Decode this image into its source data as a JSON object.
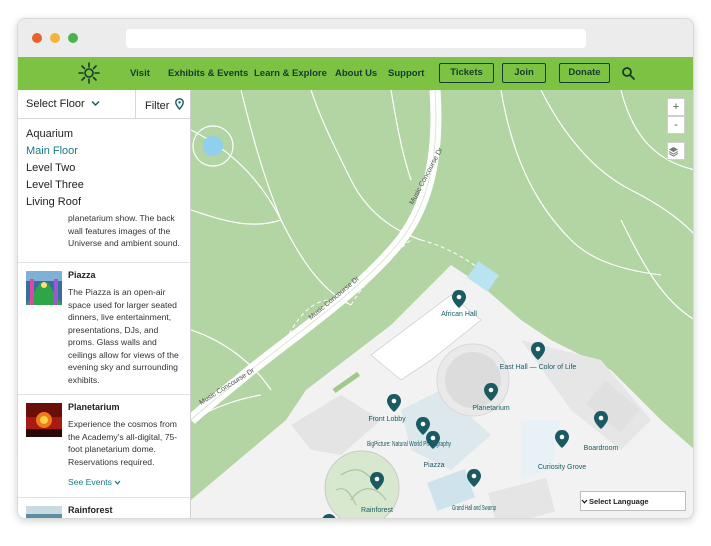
{
  "nav": {
    "links": [
      "Visit",
      "Exhibits & Events",
      "Learn & Explore",
      "About Us",
      "Support"
    ],
    "buttons": [
      "Tickets",
      "Join",
      "Donate"
    ]
  },
  "sidebar": {
    "select_floor": "Select Floor",
    "filter": "Filter",
    "floors": [
      "Aquarium",
      "Main Floor",
      "Level Two",
      "Level Three",
      "Living Roof"
    ],
    "active_floor": "Main Floor",
    "partial_desc": "planetarium show. The back wall features images of the Universe and ambient sound.",
    "items": [
      {
        "title": "Piazza",
        "desc": "The Piazza is an open-air space used for larger seated dinners, live entertainment, presentations, DJs, and proms. Glass walls and ceilings allow for views of the evening sky and surrounding exhibits."
      },
      {
        "title": "Planetarium",
        "desc": "Experience the cosmos from the Academy's all-digital, 75-foot planetarium dome. Reservations required.",
        "more": "See Events"
      },
      {
        "title": "Rainforest"
      }
    ]
  },
  "map": {
    "streets": [
      "Music Concourse Dr",
      "Music Concourse Dr",
      "Music Concourse Dr"
    ],
    "pois": [
      "African Hall",
      "East Hall — Color of Life",
      "Planetarium",
      "Front Lobby",
      "BigPicture: Natural World Photography",
      "Piazza",
      "Boardroom",
      "Curiosity Grove",
      "Grand Hall and Swamp",
      "Rainforest"
    ],
    "zoom_in": "+",
    "zoom_out": "-",
    "language": "Select Language"
  },
  "colors": {
    "nav_green": "#7dc242",
    "teal": "#1a5a63",
    "map_green": "#b3d4a3"
  }
}
